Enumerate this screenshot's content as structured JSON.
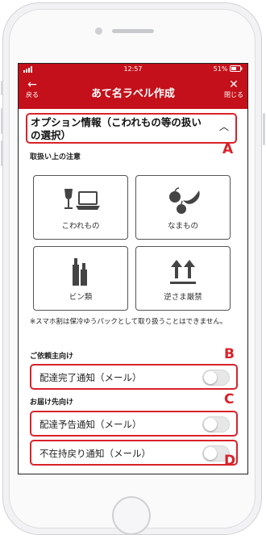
{
  "status_bar": {
    "time": "12:57",
    "battery": "51%"
  },
  "header": {
    "back_label": "戻る",
    "title": "あて名ラベル作成",
    "close_label": "閉じる"
  },
  "option_section": {
    "title": "オプション情報（こわれもの等の扱いの選択）"
  },
  "handling": {
    "label": "取扱い上の注意",
    "cards": [
      {
        "label": "こわれもの",
        "icon": "fragile-icon"
      },
      {
        "label": "なまもの",
        "icon": "perishable-icon"
      },
      {
        "label": "ビン類",
        "icon": "bottles-icon"
      },
      {
        "label": "逆さま厳禁",
        "icon": "this-side-up-icon"
      }
    ],
    "note": "※スマホ割は保冷ゆうパックとして取り扱うことはできません。"
  },
  "sender": {
    "label": "ご依頼主向け",
    "toggles": [
      {
        "label": "配達完了通知（メール）",
        "on": false
      }
    ]
  },
  "recipient": {
    "label": "お届け先向け",
    "toggles": [
      {
        "label": "配達予告通知（メール）",
        "on": false
      },
      {
        "label": "不在持戻り通知（メール）",
        "on": false
      }
    ]
  },
  "markers": {
    "a": "A",
    "b": "B",
    "c": "C",
    "d": "D"
  },
  "colors": {
    "brand_red": "#c4101a",
    "highlight": "#d9222a"
  }
}
